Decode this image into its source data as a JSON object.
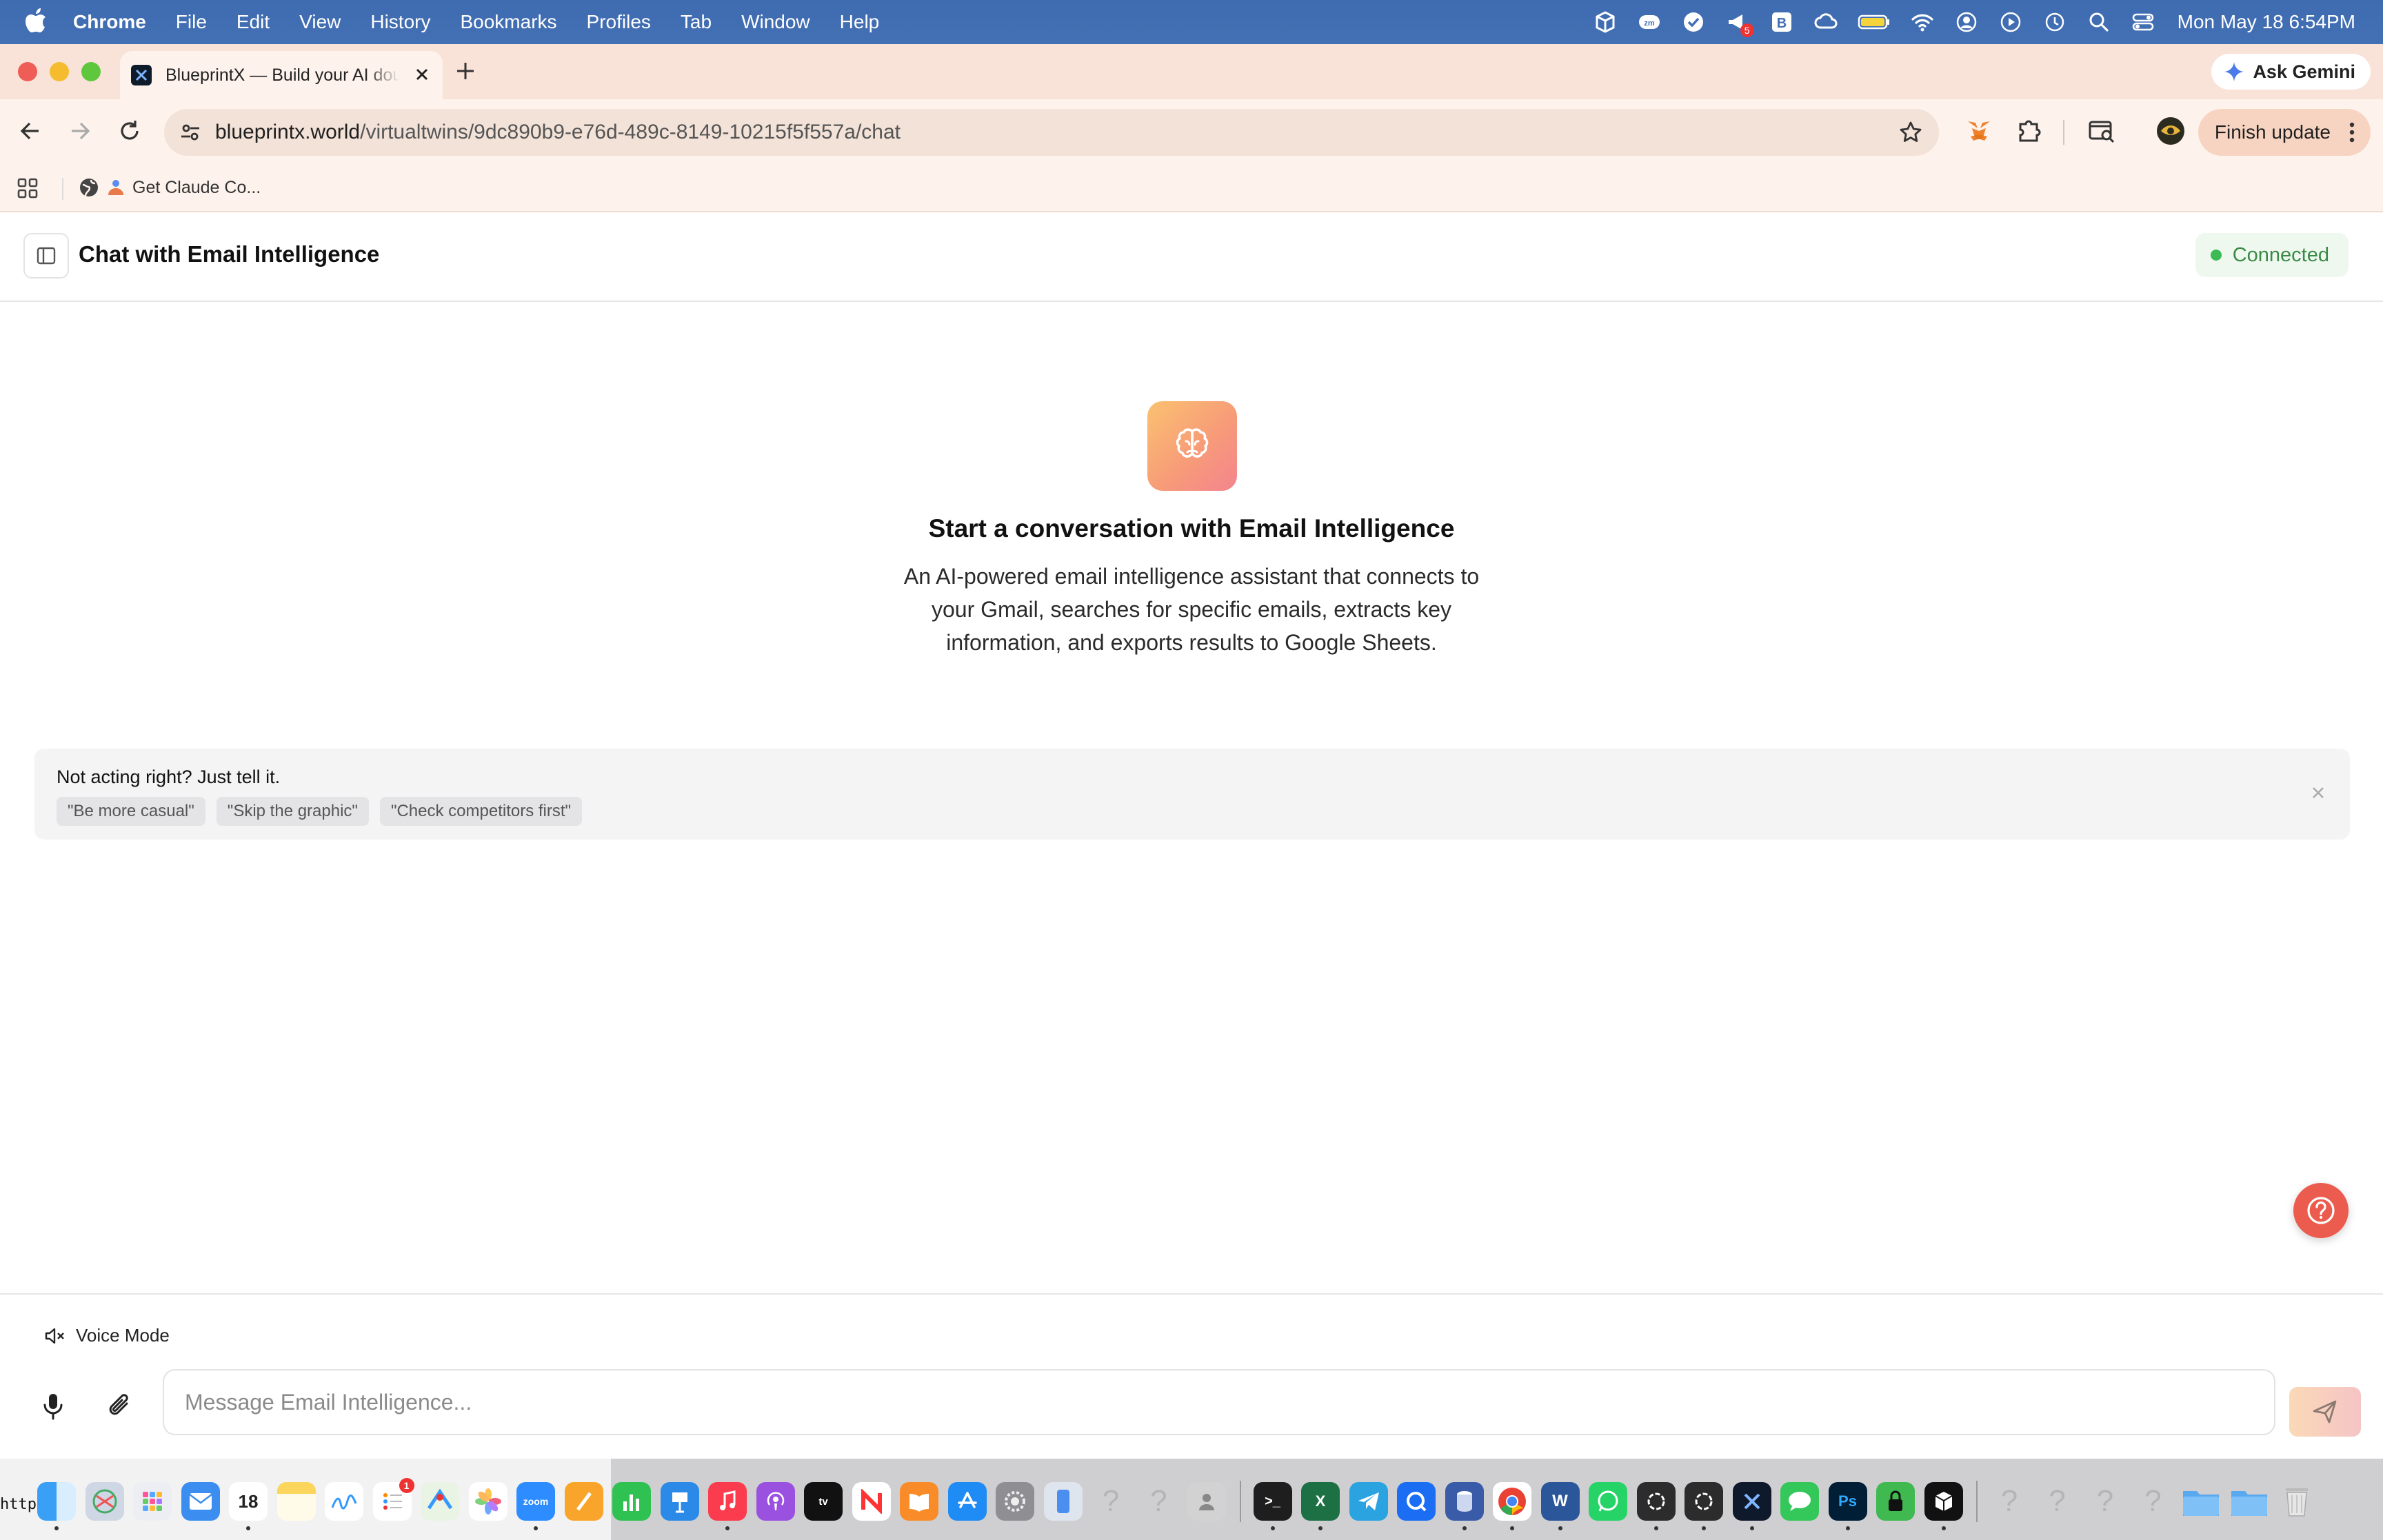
{
  "menubar": {
    "items": [
      "Chrome",
      "File",
      "Edit",
      "View",
      "History",
      "Bookmarks",
      "Profiles",
      "Tab",
      "Window",
      "Help"
    ],
    "clock": "Mon May 18  6:54PM",
    "notification_badge": "5"
  },
  "browser": {
    "tab_title": "BlueprintX — Build your AI double",
    "url_host": "blueprintx.world",
    "url_path": "/virtualtwins/9dc890b9-e76d-489c-8149-10215f5f557a/chat",
    "ask_gemini": "Ask Gemini",
    "finish_update": "Finish update",
    "bookmark_label": "Get Claude Co..."
  },
  "header": {
    "title": "Chat with Email Intelligence",
    "status": "Connected"
  },
  "empty_state": {
    "title": "Start a conversation with Email Intelligence",
    "description": "An AI-powered email intelligence assistant that connects to your Gmail, searches for specific emails, extracts key information, and exports results to Google Sheets."
  },
  "tip": {
    "title": "Not acting right? Just tell it.",
    "chips": [
      "\"Be more casual\"",
      "\"Skip the graphic\"",
      "\"Check competitors first\""
    ]
  },
  "composer": {
    "voice_mode": "Voice Mode",
    "placeholder": "Message Email Intelligence...",
    "value": ""
  },
  "dock": {
    "calendar_day": "18",
    "reminders_badge": "1"
  },
  "terminal": {
    "visible_text": "http"
  },
  "colors": {
    "menubar": "#4370b4",
    "tabstrip": "#f9e3d8",
    "connected_green": "#3cba54",
    "help_fab": "#eb5c4e"
  }
}
